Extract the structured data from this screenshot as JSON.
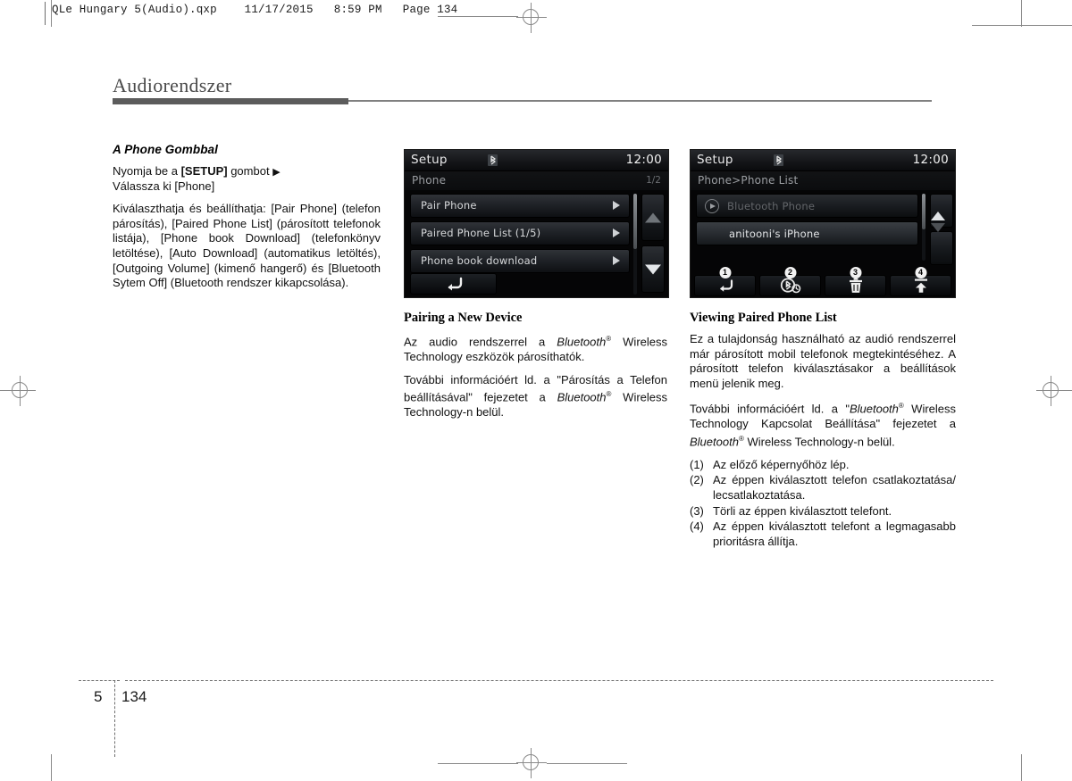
{
  "print_header": {
    "text": "QLe Hungary 5(Audio).qxp    11/17/2015   8:59 PM   Page 134"
  },
  "chapter": {
    "title": "Audiorendszer",
    "number": "5",
    "page": "134"
  },
  "left_column": {
    "heading": "A Phone Gombbal",
    "instruction_prefix": "Nyomja be a ",
    "instruction_button": "[SETUP]",
    "instruction_mid": " gombot ",
    "instruction_arrow": "▶",
    "instruction_line2": "Válassza ki [Phone]",
    "paragraph": "Kiválaszthatja és beállíthatja: [Pair Phone] (telefon párosítás), [Paired Phone List] (párosított telefonok listája), [Phone book Download] (telefonkönyv letöltése), [Auto Download] (automatikus letöltés), [Outgoing Volume] (kimenő hangerő) és [Bluetooth Sytem Off] (Bluetooth rendszer kikapcsolása)."
  },
  "device_setup_phone": {
    "title": "Setup",
    "clock": "12:00",
    "bluetooth_icon": "bluetooth-icon",
    "breadcrumb": "Phone",
    "page_index": "1/2",
    "rows": [
      {
        "label": "Pair Phone",
        "arrow": "▶"
      },
      {
        "label": "Paired Phone List  (1/5)",
        "arrow": "▶"
      },
      {
        "label": "Phone book download",
        "arrow": "▶"
      }
    ],
    "nav_up": "scroll-up-icon",
    "nav_down": "scroll-down-icon",
    "back_button": "back-arrow-icon"
  },
  "device_phone_list": {
    "title": "Setup",
    "clock": "12:00",
    "bluetooth_icon": "bluetooth-icon",
    "breadcrumb": "Phone>Phone List",
    "rows": [
      {
        "label": "Bluetooth Phone",
        "icon": "play-circle-icon",
        "state": "dimmed"
      },
      {
        "label": "anitooni's iPhone",
        "state": "selected"
      }
    ],
    "nav_up": "scroll-up-icon",
    "nav_down": "scroll-down-icon",
    "toolbar": [
      {
        "badge": "1",
        "icon": "back-arrow-icon",
        "name": "back-button"
      },
      {
        "badge": "2",
        "icon": "bluetooth-connect-icon",
        "name": "connect-disconnect-button"
      },
      {
        "badge": "3",
        "icon": "trash-icon",
        "name": "delete-button"
      },
      {
        "badge": "4",
        "icon": "priority-up-icon",
        "name": "set-priority-button"
      }
    ]
  },
  "mid_column": {
    "heading": "Pairing a New Device",
    "p1_a": "Az audio rendszerrel a ",
    "p1_bt": "Bluetooth",
    "p1_sup": "®",
    "p1_b": " Wireless Technology eszközök párosíthatók.",
    "p2_a": "További információért ld. a \"Párosítás a Telefon beállításával\" fejezetet a ",
    "p2_bt": "Bluetooth",
    "p2_sup": "®",
    "p2_b": " Wireless Technology-n belül."
  },
  "right_column": {
    "heading": "Viewing Paired Phone List",
    "p1": "Ez a tulajdonság használható az audió rendszerrel már párosított mobil telefonok megtekintéséhez. A párosított telefon kiválasztásakor a beállítások menü jelenik meg.",
    "p2_a": "További információért ld. a \"",
    "p2_bt1": "Bluetooth",
    "p2_sup1": "®",
    "p2_b": " Wireless Technology Kapcsolat Beállítása\" fejezetet a ",
    "p2_bt2": "Bluetooth",
    "p2_sup2": "®",
    "p2_c": " Wireless Technology-n belül.",
    "items": [
      {
        "label": "(1)",
        "text": "Az előző képernyőhöz lép."
      },
      {
        "label": "(2)",
        "text": "Az éppen kiválasztott telefon csatlakoztatása/ lecsatlakoztatása."
      },
      {
        "label": "(3)",
        "text": "Törli az éppen kiválasztott telefont."
      },
      {
        "label": "(4)",
        "text": "Az éppen kiválasztott telefont a legmagasabb prioritásra állítja."
      }
    ]
  }
}
